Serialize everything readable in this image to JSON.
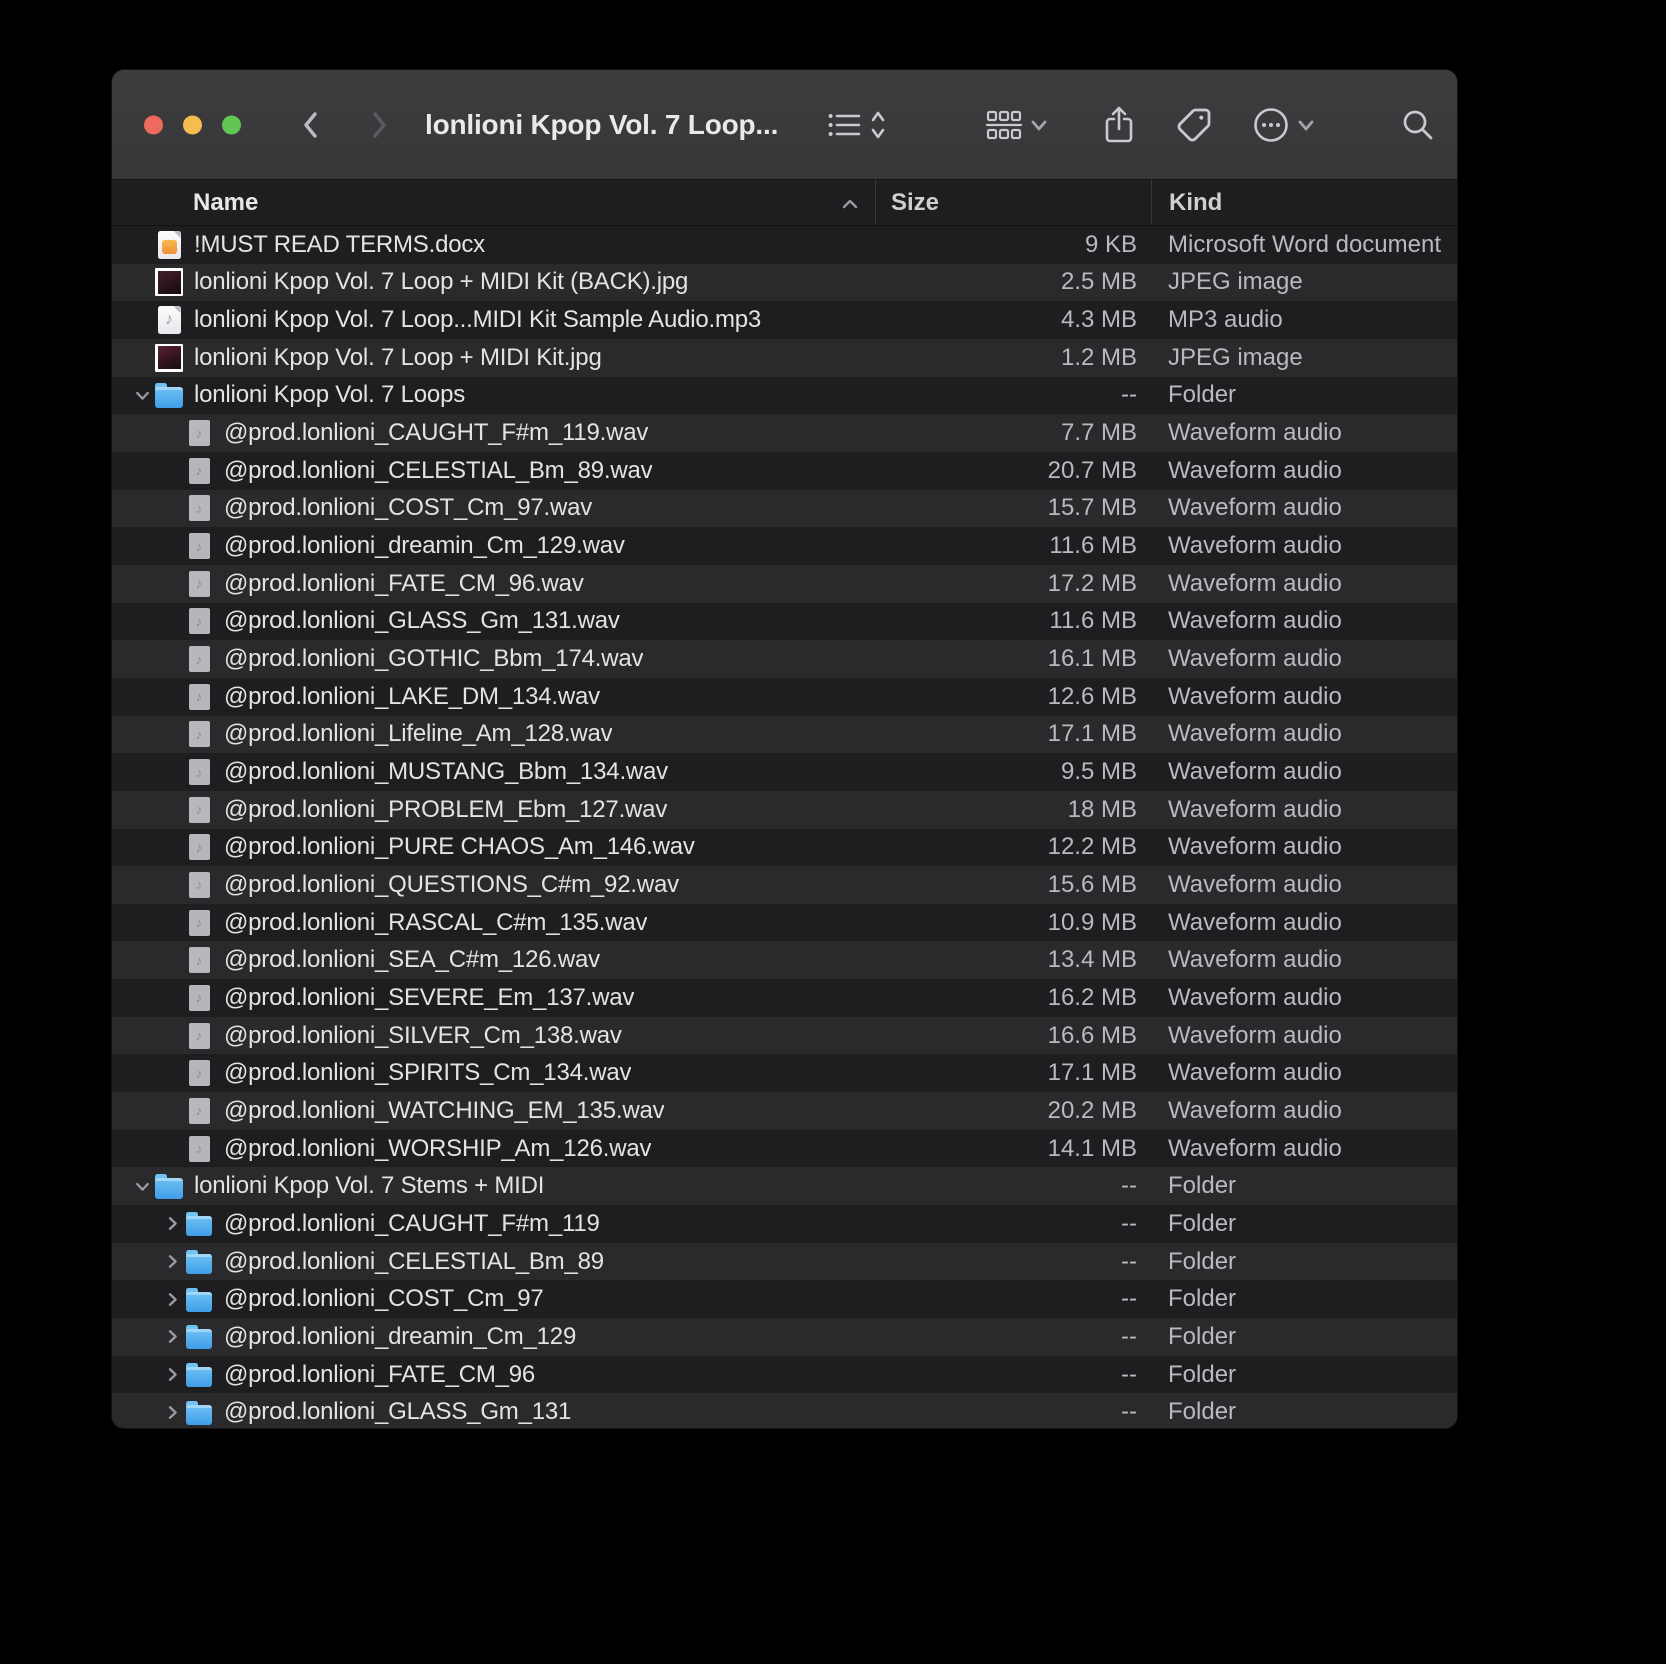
{
  "window": {
    "title": "lonlioni Kpop Vol. 7 Loop...",
    "traffic_lights": {
      "close": "#ee6a5f",
      "minimize": "#f5bd4f",
      "zoom": "#61c554"
    }
  },
  "toolbar": {
    "icons": [
      "back",
      "forward",
      "list-view",
      "group-by",
      "share",
      "tag",
      "more",
      "search"
    ]
  },
  "columns": {
    "name": "Name",
    "size": "Size",
    "kind": "Kind",
    "sort_direction": "ascending"
  },
  "colors": {
    "row_dark": "#1e1e20",
    "row_light": "#2a2a2c",
    "titlebar": "#3a3a3c",
    "text_primary": "#e3e3e5",
    "text_secondary": "#b9b9be",
    "folder_top": "#70c2f4",
    "folder_bottom": "#3f9de8",
    "icon_stroke": "#c9c9ce"
  },
  "rows": [
    {
      "name": "!MUST READ TERMS.docx",
      "size": "9 KB",
      "kind": "Microsoft Word document",
      "icon": "word",
      "level": 0,
      "disclosure": "none"
    },
    {
      "name": "lonlioni Kpop Vol. 7 Loop + MIDI Kit (BACK).jpg",
      "size": "2.5 MB",
      "kind": "JPEG image",
      "icon": "jpg1",
      "level": 0,
      "disclosure": "none"
    },
    {
      "name": "lonlioni Kpop Vol. 7 Loop...MIDI Kit Sample Audio.mp3",
      "size": "4.3 MB",
      "kind": "MP3 audio",
      "icon": "mp3",
      "level": 0,
      "disclosure": "none"
    },
    {
      "name": "lonlioni Kpop Vol. 7 Loop + MIDI Kit.jpg",
      "size": "1.2 MB",
      "kind": "JPEG image",
      "icon": "jpg2",
      "level": 0,
      "disclosure": "none"
    },
    {
      "name": "lonlioni Kpop Vol. 7 Loops",
      "size": "--",
      "kind": "Folder",
      "icon": "folder",
      "level": 0,
      "disclosure": "expanded"
    },
    {
      "name": "@prod.lonlioni_CAUGHT_F#m_119.wav",
      "size": "7.7 MB",
      "kind": "Waveform audio",
      "icon": "wav",
      "level": 1,
      "disclosure": "none"
    },
    {
      "name": "@prod.lonlioni_CELESTIAL_Bm_89.wav",
      "size": "20.7 MB",
      "kind": "Waveform audio",
      "icon": "wav",
      "level": 1,
      "disclosure": "none"
    },
    {
      "name": "@prod.lonlioni_COST_Cm_97.wav",
      "size": "15.7 MB",
      "kind": "Waveform audio",
      "icon": "wav",
      "level": 1,
      "disclosure": "none"
    },
    {
      "name": "@prod.lonlioni_dreamin_Cm_129.wav",
      "size": "11.6 MB",
      "kind": "Waveform audio",
      "icon": "wav",
      "level": 1,
      "disclosure": "none"
    },
    {
      "name": "@prod.lonlioni_FATE_CM_96.wav",
      "size": "17.2 MB",
      "kind": "Waveform audio",
      "icon": "wav",
      "level": 1,
      "disclosure": "none"
    },
    {
      "name": "@prod.lonlioni_GLASS_Gm_131.wav",
      "size": "11.6 MB",
      "kind": "Waveform audio",
      "icon": "wav",
      "level": 1,
      "disclosure": "none"
    },
    {
      "name": "@prod.lonlioni_GOTHIC_Bbm_174.wav",
      "size": "16.1 MB",
      "kind": "Waveform audio",
      "icon": "wav",
      "level": 1,
      "disclosure": "none"
    },
    {
      "name": "@prod.lonlioni_LAKE_DM_134.wav",
      "size": "12.6 MB",
      "kind": "Waveform audio",
      "icon": "wav",
      "level": 1,
      "disclosure": "none"
    },
    {
      "name": "@prod.lonlioni_Lifeline_Am_128.wav",
      "size": "17.1 MB",
      "kind": "Waveform audio",
      "icon": "wav",
      "level": 1,
      "disclosure": "none"
    },
    {
      "name": "@prod.lonlioni_MUSTANG_Bbm_134.wav",
      "size": "9.5 MB",
      "kind": "Waveform audio",
      "icon": "wav",
      "level": 1,
      "disclosure": "none"
    },
    {
      "name": "@prod.lonlioni_PROBLEM_Ebm_127.wav",
      "size": "18 MB",
      "kind": "Waveform audio",
      "icon": "wav",
      "level": 1,
      "disclosure": "none"
    },
    {
      "name": "@prod.lonlioni_PURE CHAOS_Am_146.wav",
      "size": "12.2 MB",
      "kind": "Waveform audio",
      "icon": "wav",
      "level": 1,
      "disclosure": "none"
    },
    {
      "name": "@prod.lonlioni_QUESTIONS_C#m_92.wav",
      "size": "15.6 MB",
      "kind": "Waveform audio",
      "icon": "wav",
      "level": 1,
      "disclosure": "none"
    },
    {
      "name": "@prod.lonlioni_RASCAL_C#m_135.wav",
      "size": "10.9 MB",
      "kind": "Waveform audio",
      "icon": "wav",
      "level": 1,
      "disclosure": "none"
    },
    {
      "name": "@prod.lonlioni_SEA_C#m_126.wav",
      "size": "13.4 MB",
      "kind": "Waveform audio",
      "icon": "wav",
      "level": 1,
      "disclosure": "none"
    },
    {
      "name": "@prod.lonlioni_SEVERE_Em_137.wav",
      "size": "16.2 MB",
      "kind": "Waveform audio",
      "icon": "wav",
      "level": 1,
      "disclosure": "none"
    },
    {
      "name": "@prod.lonlioni_SILVER_Cm_138.wav",
      "size": "16.6 MB",
      "kind": "Waveform audio",
      "icon": "wav",
      "level": 1,
      "disclosure": "none"
    },
    {
      "name": "@prod.lonlioni_SPIRITS_Cm_134.wav",
      "size": "17.1 MB",
      "kind": "Waveform audio",
      "icon": "wav",
      "level": 1,
      "disclosure": "none"
    },
    {
      "name": "@prod.lonlioni_WATCHING_EM_135.wav",
      "size": "20.2 MB",
      "kind": "Waveform audio",
      "icon": "wav",
      "level": 1,
      "disclosure": "none"
    },
    {
      "name": "@prod.lonlioni_WORSHIP_Am_126.wav",
      "size": "14.1 MB",
      "kind": "Waveform audio",
      "icon": "wav",
      "level": 1,
      "disclosure": "none"
    },
    {
      "name": "lonlioni Kpop Vol. 7 Stems + MIDI",
      "size": "--",
      "kind": "Folder",
      "icon": "folder",
      "level": 0,
      "disclosure": "expanded"
    },
    {
      "name": "@prod.lonlioni_CAUGHT_F#m_119",
      "size": "--",
      "kind": "Folder",
      "icon": "folder",
      "level": 1,
      "disclosure": "collapsed"
    },
    {
      "name": "@prod.lonlioni_CELESTIAL_Bm_89",
      "size": "--",
      "kind": "Folder",
      "icon": "folder",
      "level": 1,
      "disclosure": "collapsed"
    },
    {
      "name": "@prod.lonlioni_COST_Cm_97",
      "size": "--",
      "kind": "Folder",
      "icon": "folder",
      "level": 1,
      "disclosure": "collapsed"
    },
    {
      "name": "@prod.lonlioni_dreamin_Cm_129",
      "size": "--",
      "kind": "Folder",
      "icon": "folder",
      "level": 1,
      "disclosure": "collapsed"
    },
    {
      "name": "@prod.lonlioni_FATE_CM_96",
      "size": "--",
      "kind": "Folder",
      "icon": "folder",
      "level": 1,
      "disclosure": "collapsed"
    },
    {
      "name": "@prod.lonlioni_GLASS_Gm_131",
      "size": "--",
      "kind": "Folder",
      "icon": "folder",
      "level": 1,
      "disclosure": "collapsed"
    }
  ]
}
